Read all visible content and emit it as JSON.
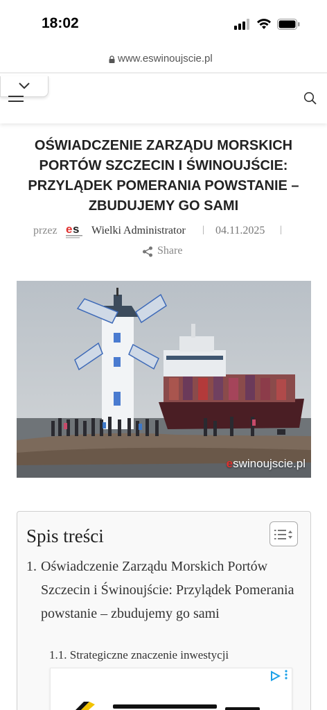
{
  "status_bar": {
    "time": "18:02"
  },
  "browser": {
    "url": "www.eswinoujscie.pl"
  },
  "article": {
    "title": "OŚWIADCZENIE ZARZĄDU MORSKICH PORTÓW SZCZECIN I ŚWINOUJŚCIE: PRZYLĄDEK POMERANIA POWSTANIE – ZBUDUJEMY GO SAMI",
    "by_label": "przez",
    "author": "Wielki Administrator",
    "separator": "|",
    "date": "04.11.2025",
    "share_label": "Share",
    "image_watermark_prefix": "e",
    "image_watermark_rest": "swinoujscie.pl"
  },
  "toc": {
    "title": "Spis treści",
    "items": [
      {
        "number": "1.",
        "label": "Oświadczenie Zarządu Morskich Portów Szczecin i Świnoujście: Przylądek Pomerania powstanie – zbudujemy go sami"
      },
      {
        "number": "1.1.",
        "label": "Strategiczne znaczenie inwestycji"
      }
    ]
  },
  "colors": {
    "brand_red": "#e0312f",
    "text_dark": "#222222",
    "muted": "#888888"
  },
  "icons": [
    "signal-icon",
    "wifi-icon",
    "battery-icon",
    "lock-icon",
    "chevron-down-icon",
    "hamburger-icon",
    "search-icon",
    "share-icon",
    "list-toggle-icon",
    "ad-choices-icon",
    "kebab-menu-icon"
  ]
}
